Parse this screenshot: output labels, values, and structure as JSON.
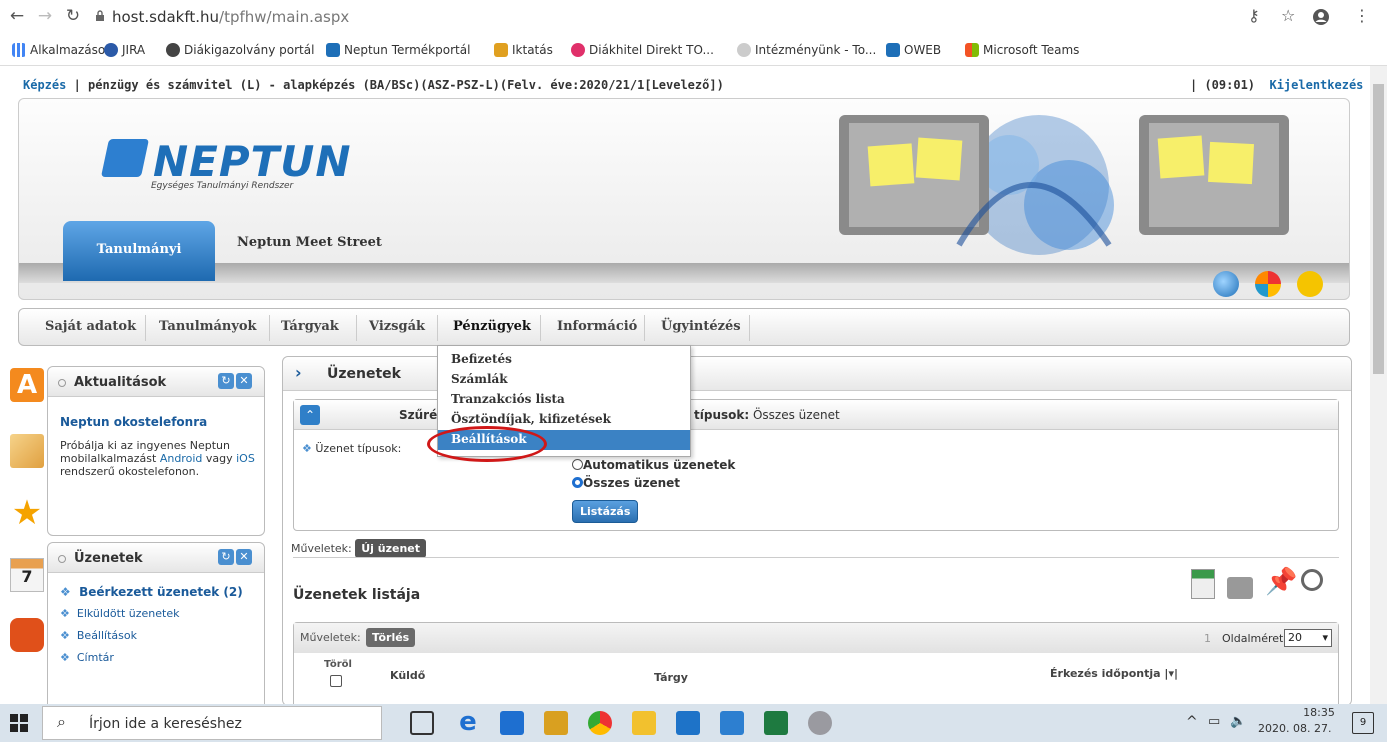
{
  "browser": {
    "url_host": "host.sdakft.hu",
    "url_path": "/tpfhw/main.aspx",
    "bookmarks": [
      {
        "label": "Alkalmazások",
        "color": "#4285f4"
      },
      {
        "label": "JIRA",
        "color": "#2b5aa8"
      },
      {
        "label": "Diákigazolvány portál",
        "color": "#444444"
      },
      {
        "label": "Neptun Termékportál",
        "color": "#1e6fb8"
      },
      {
        "label": "Iktatás",
        "color": "#e0a020"
      },
      {
        "label": "Diákhitel Direkt TO...",
        "color": "#e0306a"
      },
      {
        "label": "Intézményünk - To...",
        "color": "#888888"
      },
      {
        "label": "OWEB",
        "color": "#1e6fb8"
      },
      {
        "label": "Microsoft Teams",
        "color": "#f35325"
      }
    ]
  },
  "header": {
    "breadcrumb_link": "Képzés",
    "breadcrumb_text": "| pénzügy és számvitel (L) - alapképzés (BA/BSc)(ASZ-PSZ-L)(Felv. éve:2020/21/1[Levelező])",
    "session_time": "| (09:01)",
    "logout": "Kijelentkezés"
  },
  "banner": {
    "logo": "NEPTUN",
    "logo_sub": "Egységes Tanulmányi Rendszer",
    "tab_active": "Tanulmányi rendszer",
    "tab_other": "Neptun Meet Street"
  },
  "menu": {
    "items": [
      "Saját adatok",
      "Tanulmányok",
      "Tárgyak",
      "Vizsgák",
      "Pénzügyek",
      "Információ",
      "Ügyintézés"
    ]
  },
  "dropdown": {
    "items": [
      "Befizetés",
      "Számlák",
      "Tranzakciós lista",
      "Ösztöndíjak, kifizetések",
      "Beállítások"
    ]
  },
  "news_box": {
    "title": "Aktualitások",
    "headline": "Neptun okostelefonra",
    "text1": "Próbálja ki az ingyenes Neptun mobilalkalmazást",
    "link1": "Android",
    "text2": "vagy",
    "link2": "iOS",
    "text3": "rendszerű okostelefonon."
  },
  "messages_box": {
    "title": "Üzenetek",
    "items": [
      "Beérkezett üzenetek (2)",
      "Elküldött üzenetek",
      "Beállítások",
      "Címtár"
    ]
  },
  "main": {
    "title": "Üzenetek",
    "filter_label": "Szűrés",
    "filter_type_label": "típusok:",
    "filter_type_value": "Összes üzenet",
    "msg_types_label": "Üzenet típusok:",
    "radio_auto": "Automatikus üzenetek",
    "radio_all": "Összes üzenet",
    "list_button": "Listázás",
    "ops_label": "Műveletek:",
    "new_message": "Új üzenet",
    "list_title": "Üzenetek listája",
    "delete_button": "Törlés",
    "page_num": "1",
    "page_size_label": "Oldalméret",
    "page_size_value": "20",
    "col_delete": "Töröl",
    "col_sender": "Küldő",
    "col_subject": "Tárgy",
    "col_arrival": "Érkezés időpontja"
  },
  "taskbar": {
    "search_placeholder": "Írjon ide a kereséshez",
    "time": "18:35",
    "date": "2020. 08. 27.",
    "notif_count": "9"
  }
}
